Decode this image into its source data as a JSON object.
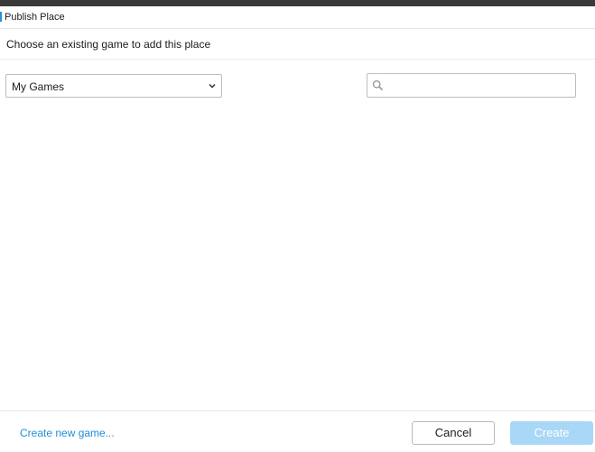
{
  "window": {
    "title": "Publish Place",
    "icon": "window-icon"
  },
  "header": {
    "instruction": "Choose an existing game to add this place"
  },
  "filter": {
    "selected": "My Games",
    "icon": "chevron-down-icon"
  },
  "search": {
    "value": "",
    "placeholder": "",
    "icon": "search-icon"
  },
  "games": [],
  "footer": {
    "create_new_label": "Create new game...",
    "cancel_label": "Cancel",
    "create_label": "Create",
    "create_enabled": false
  },
  "colors": {
    "link": "#1f8fd8",
    "create_button_disabled": "#a9d7f8",
    "title_icon": "#2a8fd6"
  }
}
